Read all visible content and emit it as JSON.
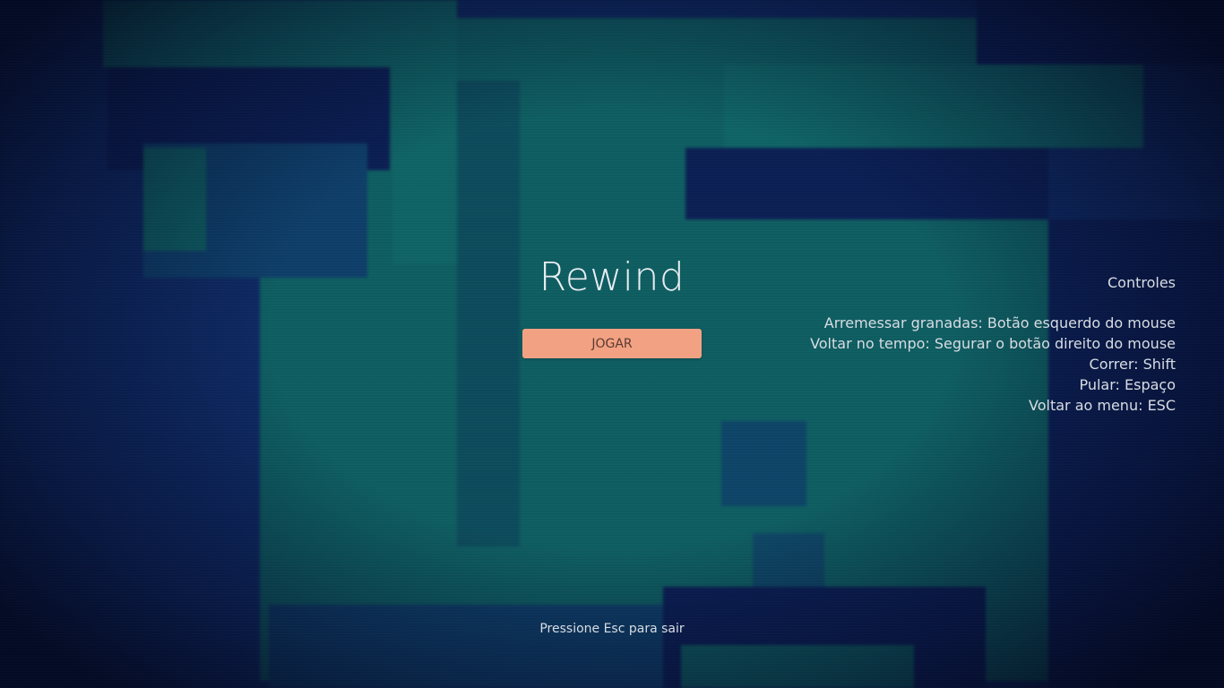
{
  "menu": {
    "title": "Rewind",
    "play_label": "JOGAR",
    "exit_hint": "Pressione Esc para sair"
  },
  "controls": {
    "title": "Controles",
    "items": [
      "Arremessar granadas: Botão esquerdo do mouse",
      "Voltar no tempo: Segurar o botão direito do mouse",
      "Correr: Shift",
      "Pular: Espaço",
      "Voltar ao menu: ESC"
    ]
  },
  "colors": {
    "button": "#f2a283",
    "text": "#d7dde3",
    "background_teal": "#0e5e62",
    "background_navy": "#0e2a64"
  }
}
